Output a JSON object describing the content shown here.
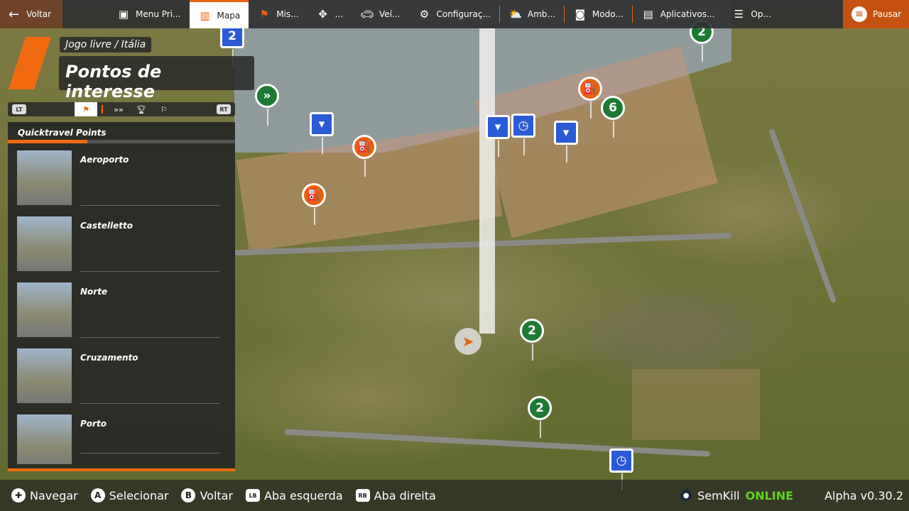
{
  "topbar": {
    "back": "Voltar",
    "tabs": [
      {
        "label": "Menu Pri...",
        "icon": "main-menu-icon"
      },
      {
        "label": "Mapa",
        "icon": "map-icon",
        "active": true
      },
      {
        "label": "Mis...",
        "icon": "mission-flag-icon"
      },
      {
        "label": "...",
        "icon": "puzzle-icon"
      },
      {
        "label": "Veí...",
        "icon": "car-icon"
      },
      {
        "label": "Configuraç...",
        "icon": "engine-icon"
      },
      {
        "label": "Amb...",
        "icon": "weather-icon"
      },
      {
        "label": "Modo...",
        "icon": "camera-icon"
      },
      {
        "label": "Aplicativos...",
        "icon": "apps-icon"
      },
      {
        "label": "Op...",
        "icon": "sliders-icon"
      }
    ],
    "pause": "Pausar"
  },
  "header": {
    "breadcrumb": "Jogo livre / Itália",
    "title": "Pontos de interesse"
  },
  "tabstrip": {
    "lt": "LT",
    "rt": "RT"
  },
  "panel": {
    "title": "Quicktravel Points",
    "items": [
      "Aeroporto",
      "Castelletto",
      "Norte",
      "Cruzamento",
      "Porto"
    ]
  },
  "map": {
    "markers": [
      "2",
      "2",
      "2",
      "2",
      "6"
    ]
  },
  "bottombar": {
    "hints": [
      {
        "key": "✚",
        "label": "Navegar"
      },
      {
        "key": "A",
        "label": "Selecionar"
      },
      {
        "key": "B",
        "label": "Voltar"
      },
      {
        "key": "LB",
        "label": "Aba esquerda"
      },
      {
        "key": "RB",
        "label": "Aba direita"
      }
    ],
    "user": "SemKill",
    "status": "ONLINE",
    "version": "Alpha v0.30.2"
  },
  "colors": {
    "accent": "#f26a10",
    "online": "#5fd321"
  }
}
